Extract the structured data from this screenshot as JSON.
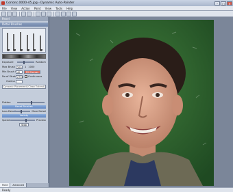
{
  "window": {
    "title": "Corlonc.0000-45.jpg - Dynamic Auto-Painter"
  },
  "menu": {
    "items": [
      "File",
      "View",
      "Action",
      "Paint",
      "View",
      "Tools",
      "Help"
    ]
  },
  "panel": {
    "header": "Panel",
    "section_title": "Detail Brushes",
    "exposure": {
      "label": "Exposure",
      "value": "1",
      "random_label": "Random"
    },
    "max_brush_size": {
      "label": "Max Brush Size",
      "value": "200",
      "extra": "1",
      "extra2": "1000"
    },
    "min_brush_size": {
      "label": "Min Brush Size",
      "value": "40",
      "button": "Fill Canvas"
    },
    "no_of_strokes": {
      "label": "No of Strokes",
      "value": "2750",
      "checkbox_label": "Continuous",
      "checked": true
    },
    "outline_label": "Outline",
    "dropdown_value": "Dynamic Placement (Clean Extend)",
    "flatten_label": "Flatten",
    "reset_button": "Reset Brushes",
    "less_detail_label": "Less Detail",
    "more_detail_label": "More Detail",
    "variety_button": "Variety",
    "speed_label": "Speed",
    "preview_label": "Preview",
    "stop_button": "Stop",
    "tabs": [
      "Paint",
      "Advanced"
    ]
  },
  "status": {
    "text": "Ready"
  }
}
